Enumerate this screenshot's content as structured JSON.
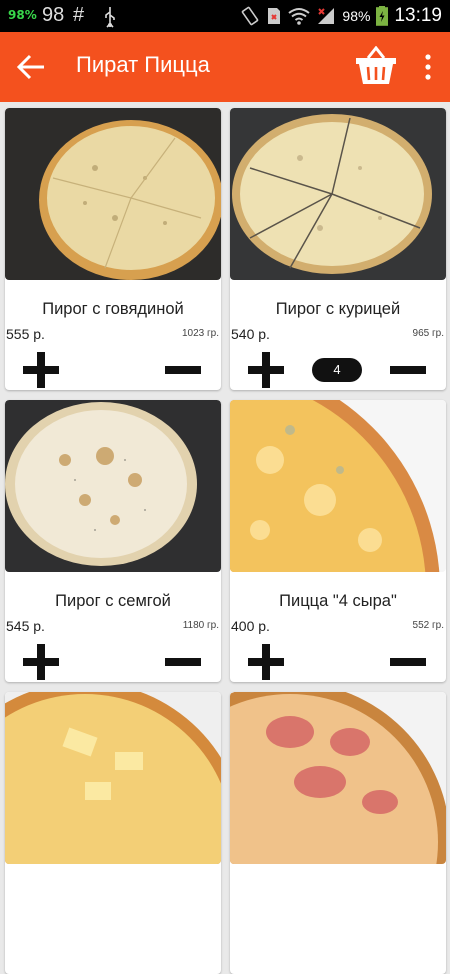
{
  "statusbar": {
    "battery_left": "98%",
    "notif_num": "98",
    "notif_hash": "#",
    "battery_pct": "98%",
    "time": "13:19"
  },
  "appbar": {
    "title": "Пират Пицца",
    "back_icon": "arrow-back-icon",
    "basket_icon": "basket-icon",
    "more_icon": "more-vert-icon"
  },
  "products": [
    {
      "name": "Пирог с говядиной",
      "price": "555 р.",
      "weight": "1023 гр.",
      "count": ""
    },
    {
      "name": "Пирог с курицей",
      "price": "540 р.",
      "weight": "965 гр.",
      "count": "4"
    },
    {
      "name": "Пирог с семгой",
      "price": "545 р.",
      "weight": "1180 гр.",
      "count": ""
    },
    {
      "name": "Пицца \"4 сыра\"",
      "price": "400 р.",
      "weight": "552 гр.",
      "count": ""
    },
    {
      "name": "",
      "price": "",
      "weight": "",
      "count": ""
    },
    {
      "name": "",
      "price": "",
      "weight": "",
      "count": ""
    }
  ],
  "colors": {
    "accent": "#f4511e",
    "statusbar": "#000000",
    "background": "#e9e9e9"
  }
}
